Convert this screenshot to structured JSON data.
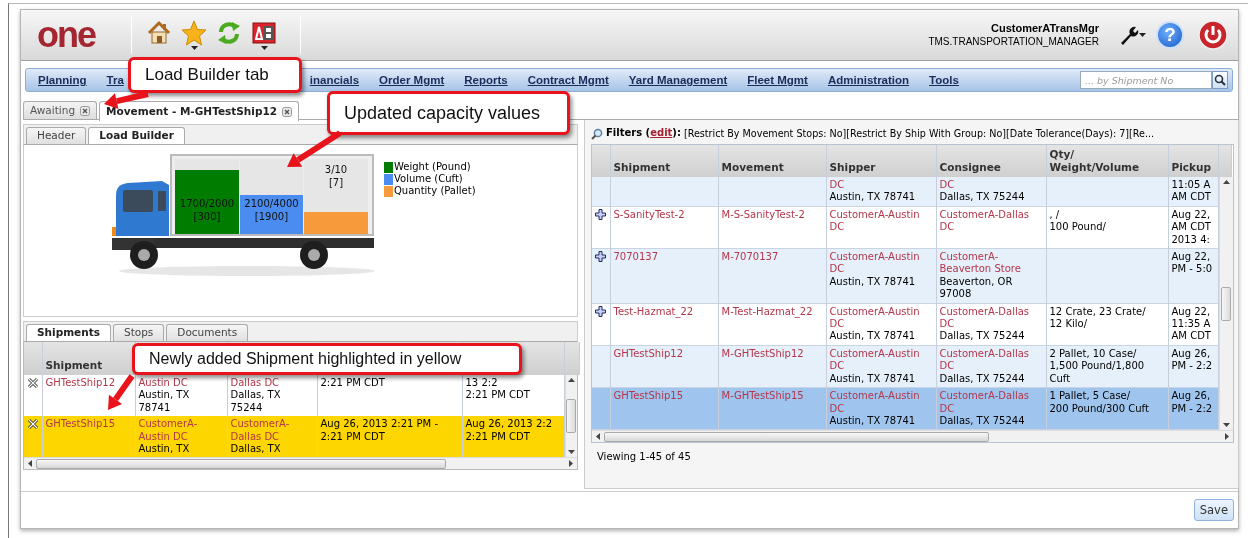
{
  "header": {
    "logo": "one",
    "user": "CustomerATransMgr",
    "role": "TMS.TRANSPORTATION_MANAGER",
    "help": "?"
  },
  "nav": {
    "items": [
      "Planning",
      "Tra",
      "inancials",
      "Order Mgmt",
      "Reports",
      "Contract Mgmt",
      "Yard Management",
      "Fleet Mgmt",
      "Administration",
      "Tools"
    ],
    "search": {
      "placeholder": "... by Shipment No"
    }
  },
  "doc_tabs": [
    {
      "label": "Awaiting",
      "selected": false
    },
    {
      "label": "Movement - M-GHTestShip12",
      "selected": true
    }
  ],
  "movement_tabs": [
    {
      "label": "Header",
      "selected": false
    },
    {
      "label": "Load Builder",
      "selected": true
    }
  ],
  "load_builder": {
    "capacity": [
      {
        "label": "1700/2000",
        "remaining": "[300]",
        "level": 0.85,
        "color": "#007c00",
        "legend": "Weight (Pound)"
      },
      {
        "label": "2100/4000",
        "remaining": "[1900]",
        "level": 0.525,
        "color": "#4a8cf0",
        "legend": "Volume (Cuft)"
      },
      {
        "label": "3/10",
        "remaining": "[7]",
        "level": 0.3,
        "color": "#f79a3c",
        "legend": "Quantity (Pallet)"
      }
    ]
  },
  "detail_tabs": [
    {
      "label": "Shipments",
      "selected": true
    },
    {
      "label": "Stops",
      "selected": false
    },
    {
      "label": "Documents",
      "selected": false
    }
  ],
  "shipments": {
    "columns": [
      "Shipment"
    ],
    "rows": [
      {
        "shipment": "GHTestShip12",
        "shipper": {
          "name": [
            "Austin DC"
          ],
          "address": [
            "Austin, TX",
            "78741"
          ]
        },
        "consignee": {
          "name": [
            "Dallas DC"
          ],
          "address": [
            "Dallas, TX",
            "75244"
          ]
        },
        "pickup": [
          "2:21 PM CDT"
        ],
        "delivery": [
          "13 2:2",
          "2:21 PM CDT"
        ],
        "highlighted": false
      },
      {
        "shipment": "GHTestShip15",
        "shipper": {
          "name": [
            "CustomerA-",
            "Austin DC"
          ],
          "address": [
            "Austin, TX"
          ]
        },
        "consignee": {
          "name": [
            "CustomerA-",
            "Dallas DC"
          ],
          "address": [
            "Dallas, TX"
          ]
        },
        "pickup": [
          "Aug 26, 2013 2:21 PM -",
          "2:21 PM CDT"
        ],
        "delivery": [
          "Aug 26, 2013 2:2",
          "2:21 PM CDT"
        ],
        "highlighted": true
      }
    ]
  },
  "filters": {
    "label": "Filters (",
    "link": "edit",
    "suffix": "):",
    "text": "[Restrict By Movement Stops: No][Restrict By Ship With Group: No][Date Tolerance(Days): 7][Re..."
  },
  "available": {
    "columns": [
      "Shipment",
      "Movement",
      "Shipper",
      "Consignee",
      "Qty/\nWeight/Volume",
      "Pickup"
    ],
    "rows": [
      {
        "shipper": {
          "name": [
            "DC"
          ],
          "address": [
            "Austin, TX 78741"
          ]
        },
        "consignee": {
          "name": [
            "DC"
          ],
          "address": [
            "Dallas, TX 75244"
          ]
        },
        "pickup": [
          "11:05 A",
          "AM CDT"
        ],
        "expandable": false,
        "selected": false
      },
      {
        "shipment": "S-SanityTest-2",
        "movement": "M-S-SanityTest-2",
        "shipper": {
          "name": [
            "CustomerA-Austin",
            "DC"
          ]
        },
        "consignee": {
          "name": [
            "CustomerA-Dallas",
            "DC"
          ]
        },
        "qty": [
          ", /",
          "100 Pound/"
        ],
        "pickup": [
          "Aug 22,",
          "AM CDT",
          "2013 4:"
        ],
        "expandable": true,
        "selected": false
      },
      {
        "shipment": "7070137",
        "movement": "M-7070137",
        "shipper": {
          "name": [
            "CustomerA-Austin",
            "DC"
          ],
          "address": [
            "Austin, TX 78741"
          ]
        },
        "consignee": {
          "name": [
            "CustomerA-",
            "Beaverton Store"
          ],
          "address": [
            "Beaverton, OR",
            "97008"
          ]
        },
        "pickup": [
          "Aug 22,",
          "PM - 5:0"
        ],
        "expandable": true,
        "selected": false
      },
      {
        "shipment": "Test-Hazmat_22",
        "movement": "M-Test-Hazmat_22",
        "shipper": {
          "name": [
            "CustomerA-Austin",
            "DC"
          ],
          "address": [
            "Austin, TX 78741"
          ]
        },
        "consignee": {
          "name": [
            "CustomerA-Dallas",
            "DC"
          ],
          "address": [
            "Dallas, TX 75244"
          ]
        },
        "qty": [
          "12 Crate, 23 Crate/",
          "12 Kilo/"
        ],
        "pickup": [
          "Aug 22,",
          "11:35 A",
          "AM CDT"
        ],
        "expandable": true,
        "selected": false
      },
      {
        "shipment": "GHTestShip12",
        "movement": "M-GHTestShip12",
        "shipper": {
          "name": [
            "CustomerA-Austin",
            "DC"
          ],
          "address": [
            "Austin, TX 78741"
          ]
        },
        "consignee": {
          "name": [
            "CustomerA-Dallas",
            "DC"
          ],
          "address": [
            "Dallas, TX 75244"
          ]
        },
        "qty": [
          "2 Pallet, 10 Case/",
          "1,500 Pound/1,800",
          "Cuft"
        ],
        "pickup": [
          "Aug 26,",
          "PM - 2:2"
        ],
        "expandable": false,
        "selected": false
      },
      {
        "shipment": "GHTestShip15",
        "movement": "M-GHTestShip15",
        "shipper": {
          "name": [
            "CustomerA-Austin",
            "DC"
          ],
          "address": [
            "Austin, TX 78741"
          ]
        },
        "consignee": {
          "name": [
            "CustomerA-Dallas",
            "DC"
          ],
          "address": [
            "Dallas, TX 75244"
          ]
        },
        "qty": [
          "1 Pallet, 5 Case/",
          "200 Pound/300 Cuft"
        ],
        "pickup": [
          "Aug 26,",
          "PM - 2:2"
        ],
        "expandable": false,
        "selected": true
      }
    ],
    "footer": "Viewing 1-45 of 45"
  },
  "save": "Save",
  "callouts": [
    {
      "text": "Load Builder tab"
    },
    {
      "text": "Updated capacity values"
    },
    {
      "text": "Newly added Shipment highlighted in yellow"
    }
  ]
}
